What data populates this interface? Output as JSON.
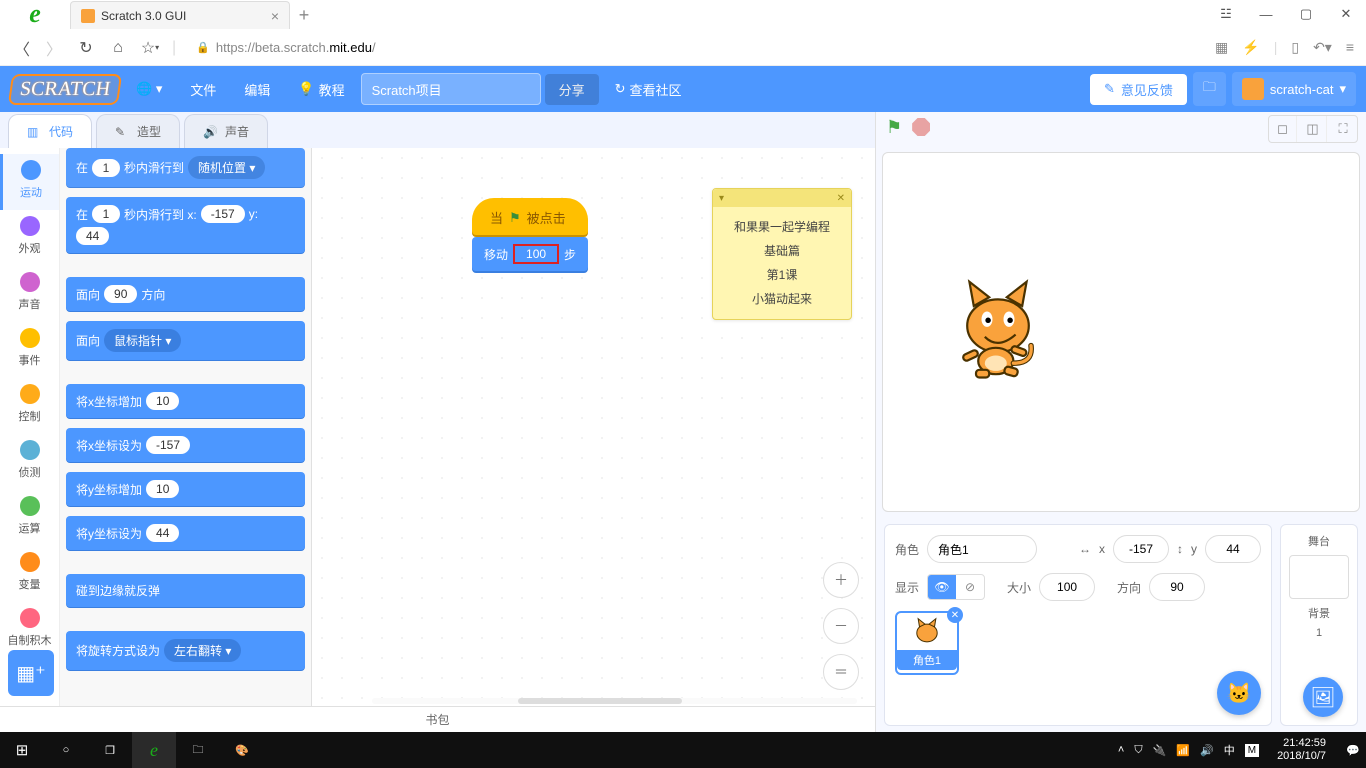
{
  "browser": {
    "tab_title": "Scratch 3.0 GUI",
    "url_scheme": "https://",
    "url_sub": "beta.scratch.",
    "url_host": "mit.edu",
    "url_path": "/"
  },
  "menubar": {
    "logo": "SCRATCH",
    "file": "文件",
    "edit": "编辑",
    "tutorials": "教程",
    "project_name": "Scratch项目",
    "share": "分享",
    "community": "查看社区",
    "feedback": "意见反馈",
    "username": "scratch-cat"
  },
  "tabs": {
    "code": "代码",
    "costumes": "造型",
    "sounds": "声音"
  },
  "categories": [
    {
      "label": "运动",
      "color": "#4c97ff",
      "active": true
    },
    {
      "label": "外观",
      "color": "#9966ff"
    },
    {
      "label": "声音",
      "color": "#cf63cf"
    },
    {
      "label": "事件",
      "color": "#ffbf00"
    },
    {
      "label": "控制",
      "color": "#ffab19"
    },
    {
      "label": "侦测",
      "color": "#5cb1d6"
    },
    {
      "label": "运算",
      "color": "#59c059"
    },
    {
      "label": "变量",
      "color": "#ff8c1a"
    },
    {
      "label": "自制积木",
      "color": "#ff6680"
    }
  ],
  "palette": {
    "glide_rand_pre": "在",
    "glide_rand_secs": "1",
    "glide_rand_mid": "秒内滑行到",
    "glide_rand_opt": "随机位置 ▾",
    "glide_xy_pre": "在",
    "glide_xy_secs": "1",
    "glide_xy_mid": "秒内滑行到 x:",
    "glide_xy_x": "-157",
    "glide_xy_ylb": "y:",
    "glide_xy_y": "44",
    "point_dir_pre": "面向",
    "point_dir_val": "90",
    "point_dir_post": "方向",
    "point_towards_pre": "面向",
    "point_towards_opt": "鼠标指针 ▾",
    "changex_pre": "将x坐标增加",
    "changex_val": "10",
    "setx_pre": "将x坐标设为",
    "setx_val": "-157",
    "changey_pre": "将y坐标增加",
    "changey_val": "10",
    "sety_pre": "将y坐标设为",
    "sety_val": "44",
    "edge_bounce": "碰到边缘就反弹",
    "rot_style_pre": "将旋转方式设为",
    "rot_style_opt": "左右翻转 ▾"
  },
  "script": {
    "hat_pre": "当",
    "hat_post": "被点击",
    "move_pre": "移动",
    "move_val": "100",
    "move_post": "步"
  },
  "comment": {
    "l1": "和果果一起学编程",
    "l2": "基础篇",
    "l3": "第1课",
    "l4": "小猫动起来"
  },
  "sprite_info": {
    "sprite_label": "角色",
    "sprite_name": "角色1",
    "x_lbl": "x",
    "x_val": "-157",
    "y_lbl": "y",
    "y_val": "44",
    "show_lbl": "显示",
    "size_lbl": "大小",
    "size_val": "100",
    "dir_lbl": "方向",
    "dir_val": "90",
    "thumb_label": "角色1"
  },
  "stage_panel": {
    "title": "舞台",
    "bg_lbl": "背景",
    "bg_count": "1"
  },
  "backpack": "书包",
  "taskbar": {
    "time": "21:42:59",
    "date": "2018/10/7"
  }
}
